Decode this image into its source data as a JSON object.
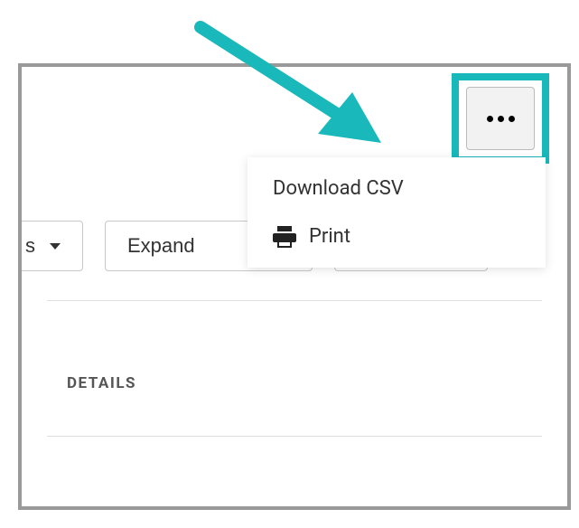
{
  "toolbar": {
    "dropdown_label": "s",
    "expand_label": "Expand",
    "hidden_label": " "
  },
  "more_menu": {
    "download_csv_label": "Download CSV",
    "print_label": "Print"
  },
  "tabs": {
    "details_label": "DETAILS"
  },
  "highlight_color": "#18b8bb"
}
